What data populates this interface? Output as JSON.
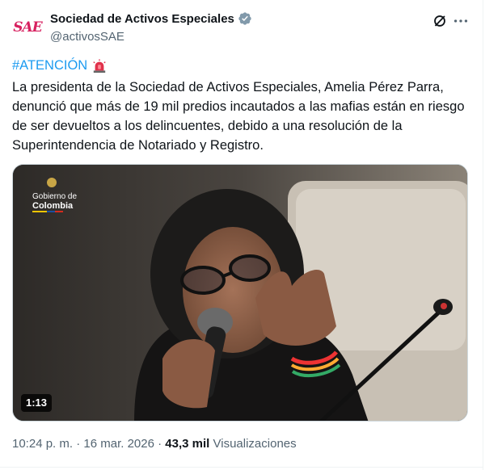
{
  "account": {
    "avatar_text": "SAE",
    "display_name": "Sociedad de Activos Especiales",
    "handle": "@activosSAE"
  },
  "tweet": {
    "hashtag": "#ATENCIÓN",
    "body": "La presidenta de la Sociedad de Activos Especiales, Amelia Pérez Parra, denunció que más  de 19 mil predios incautados a las mafias están en riesgo de ser devueltos a los delincuentes, debido a una resolución de la Superintendencia de Notariado y Registro."
  },
  "video": {
    "watermark_line1": "Gobierno de",
    "watermark_line2": "Colombia",
    "duration": "1:13"
  },
  "footer": {
    "time": "10:24 p. m.",
    "separator": " · ",
    "date": "16 mar. 2026",
    "separator2": " · ",
    "views_count": "43,3 mil",
    "views_label": " Visualizaciones"
  },
  "colors": {
    "link": "#1d9bf0",
    "secondary_text": "#536471",
    "brand": "#d7205f"
  },
  "icons": [
    "verified-badge-icon",
    "grok-icon",
    "more-icon",
    "siren-icon"
  ]
}
